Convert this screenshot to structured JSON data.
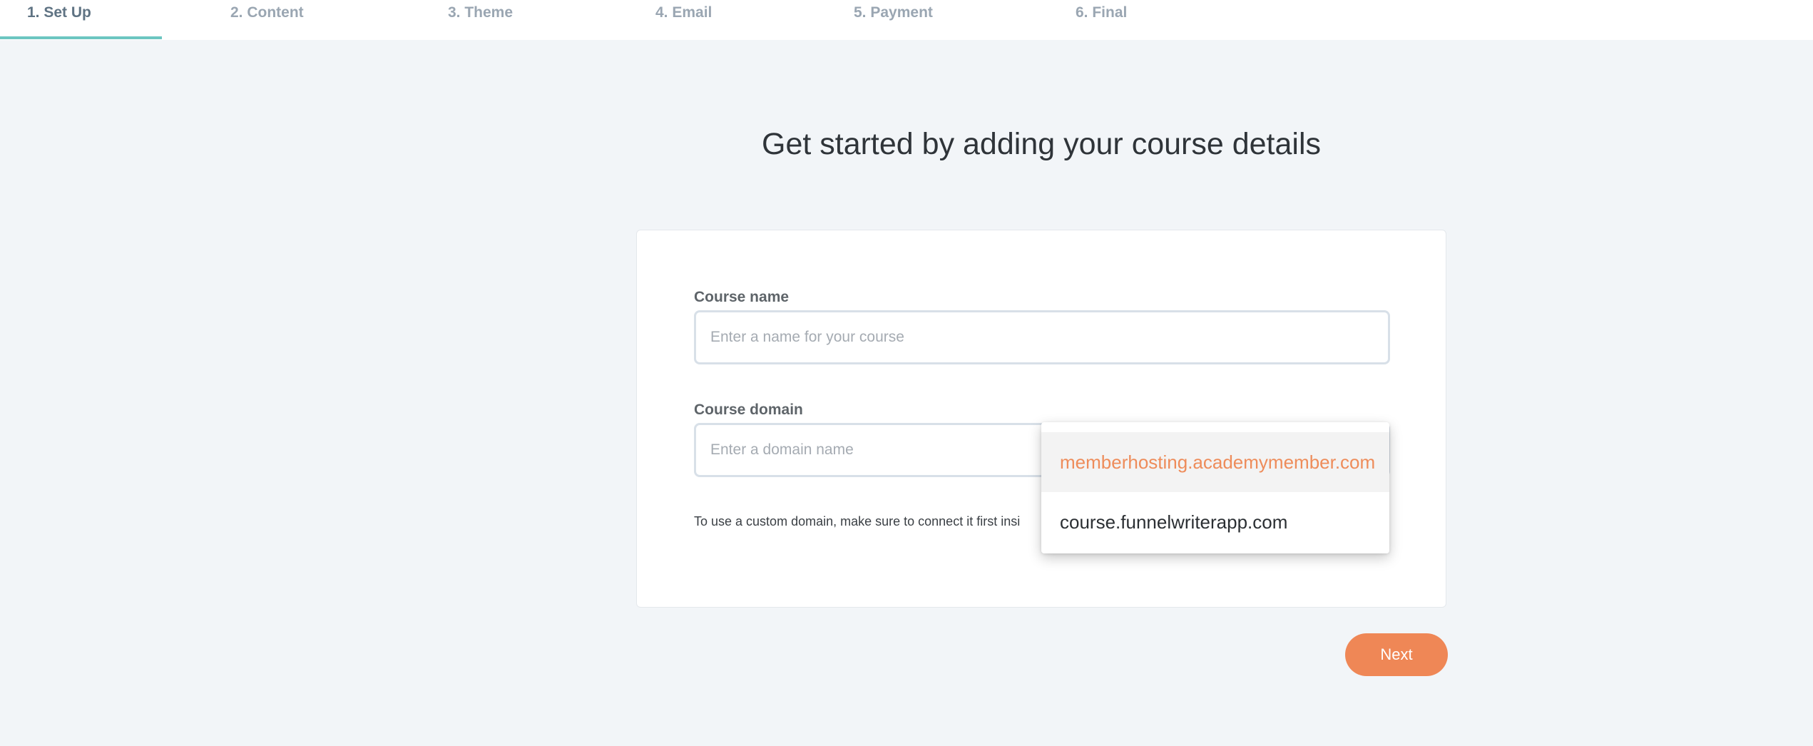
{
  "steps": [
    {
      "label": "1. Set Up",
      "active": true
    },
    {
      "label": "2. Content",
      "active": false
    },
    {
      "label": "3. Theme",
      "active": false
    },
    {
      "label": "4. Email",
      "active": false
    },
    {
      "label": "5. Payment",
      "active": false
    },
    {
      "label": "6. Final",
      "active": false
    }
  ],
  "headline": "Get started by adding your course details",
  "form": {
    "course_name": {
      "label": "Course name",
      "value": "",
      "placeholder": "Enter a name for your course"
    },
    "course_domain": {
      "label": "Course domain",
      "value": "",
      "placeholder": "Enter a domain name",
      "helper": "To use a custom domain, make sure to connect it first insi"
    }
  },
  "domain_dropdown": {
    "options": [
      {
        "label": "memberhosting.academymember.com",
        "highlighted": true
      },
      {
        "label": "course.funnelwriterapp.com",
        "highlighted": false
      }
    ]
  },
  "actions": {
    "next_label": "Next"
  },
  "colors": {
    "accent": "#ef8756",
    "active_step_underline": "#6cc6c1",
    "background": "#f2f5f8"
  }
}
